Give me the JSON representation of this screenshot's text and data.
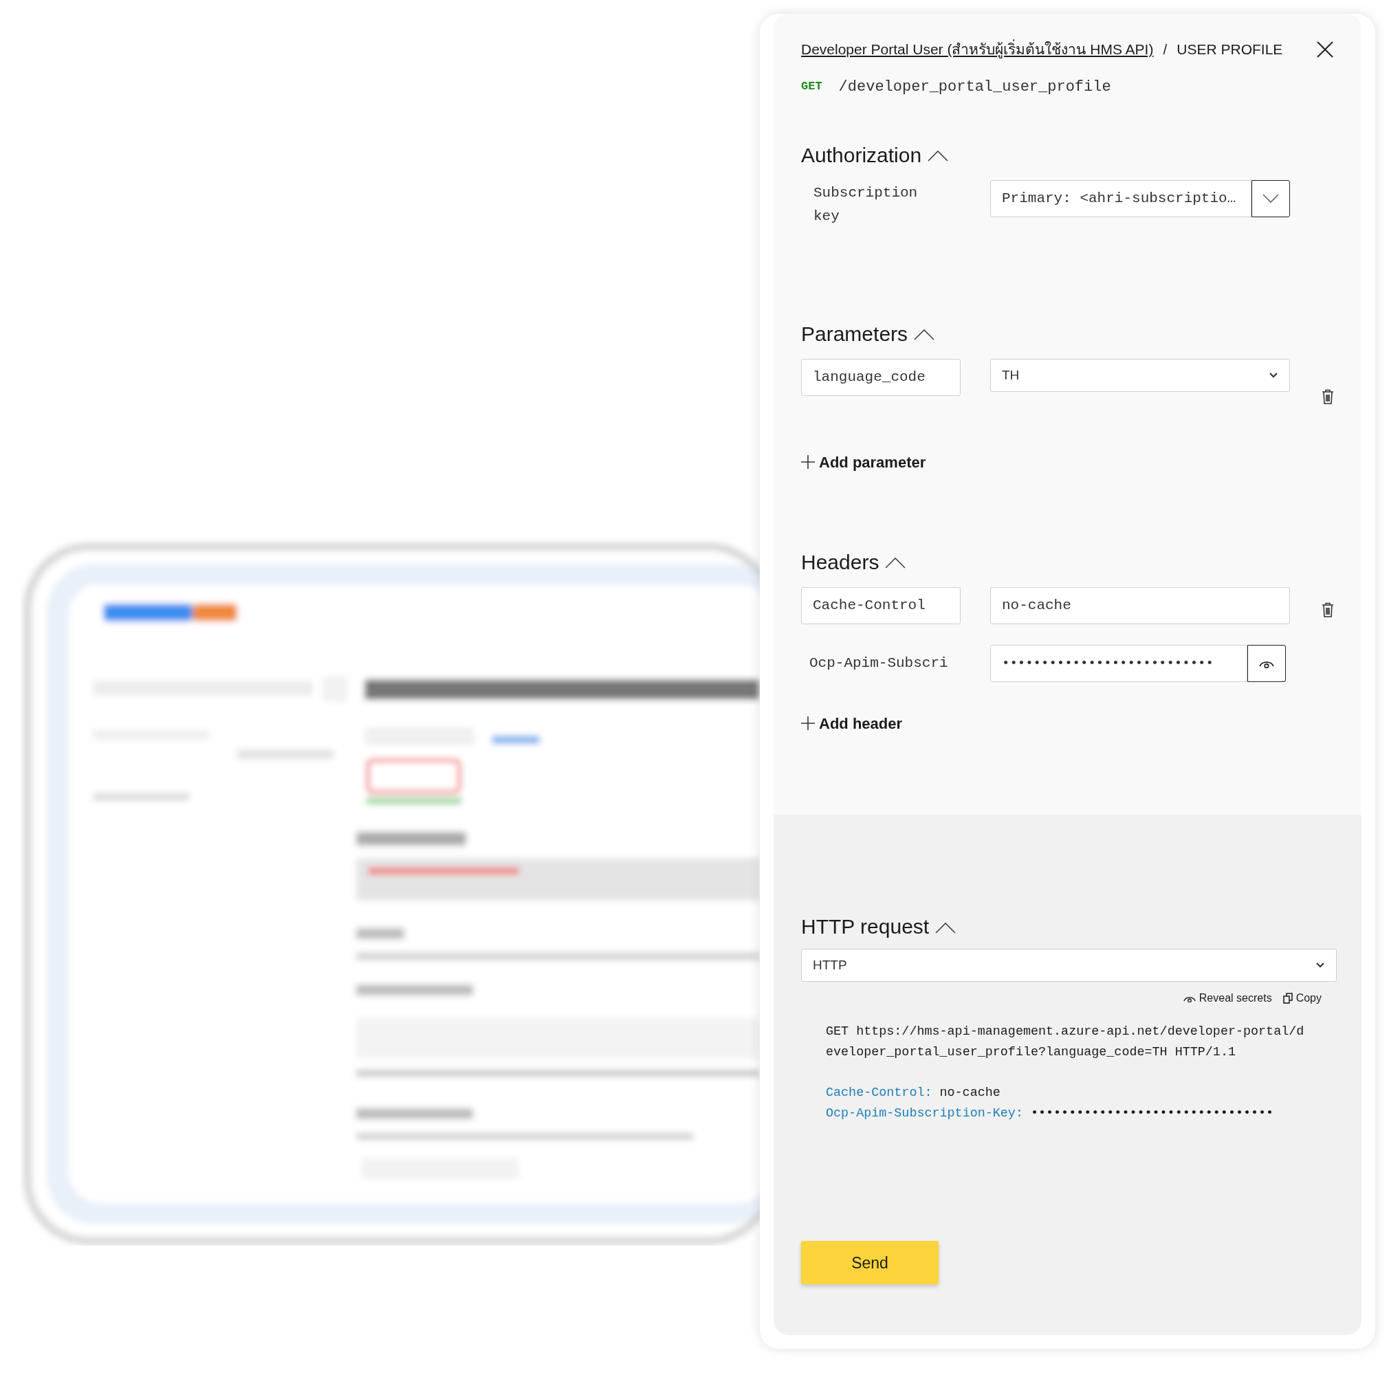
{
  "breadcrumb": {
    "link": "Developer Portal User (สำหรับผู้เริ่มต้นใช้งาน HMS API)",
    "separator": "/",
    "current": "USER PROFILE"
  },
  "operation": {
    "method": "GET",
    "path": "/developer_portal_user_profile"
  },
  "authorization": {
    "title": "Authorization",
    "expanded": true,
    "label": "Subscription key",
    "value": "Primary: <ahri-subscriptio…"
  },
  "parameters": {
    "title": "Parameters",
    "expanded": true,
    "add_label": "Add parameter",
    "items": [
      {
        "kind": "select",
        "name": "language_code",
        "value": "TH"
      }
    ]
  },
  "headers": {
    "title": "Headers",
    "expanded": true,
    "add_label": "Add header",
    "items": [
      {
        "kind": "text",
        "name": "Cache-Control",
        "value": "no-cache"
      },
      {
        "kind": "secret",
        "name": "Ocp-Apim-Subscri",
        "value": "•••••••••••••••••••••••••••"
      }
    ]
  },
  "http_request": {
    "title": "HTTP request",
    "expanded": true,
    "format": "HTTP",
    "reveal_label": "Reveal secrets",
    "copy_label": "Copy",
    "request_line": "GET https://hms-api-management.azure-api.net/developer-portal/developer_portal_user_profile?language_code=TH HTTP/1.1",
    "headers": [
      {
        "name": "Cache-Control:",
        "value": "no-cache"
      },
      {
        "name": "Ocp-Apim-Subscription-Key:",
        "value": "••••••••••••••••••••••••••••••••"
      }
    ]
  },
  "send_label": "Send"
}
